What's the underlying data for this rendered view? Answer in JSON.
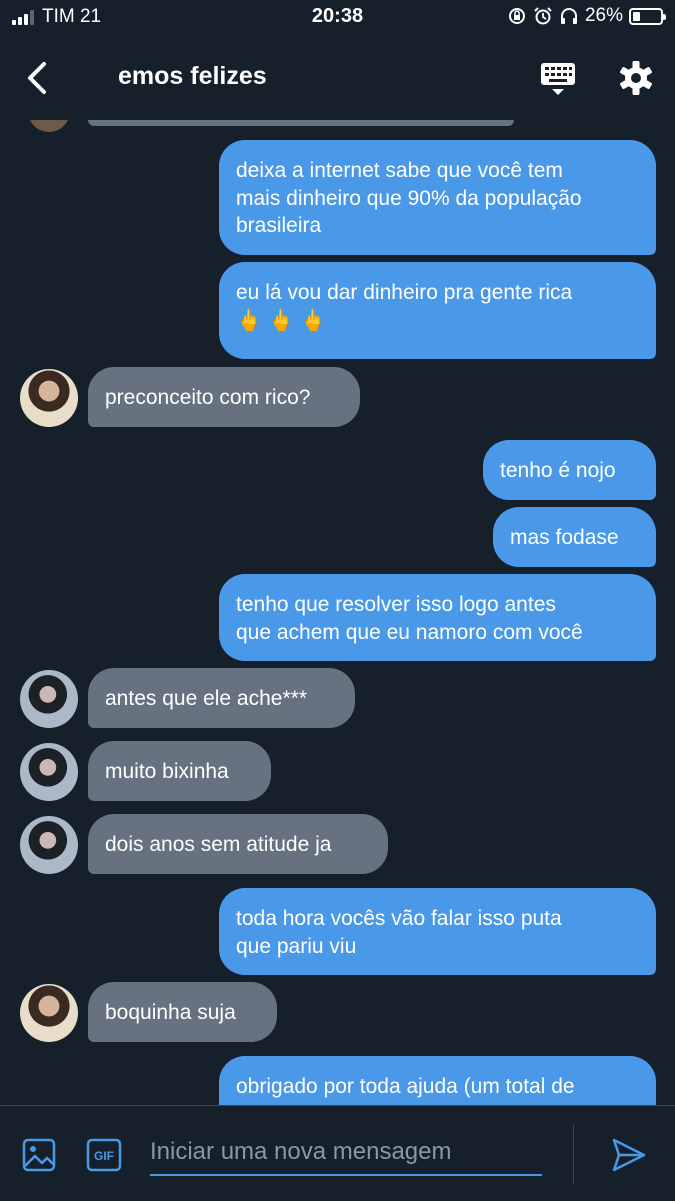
{
  "status_bar": {
    "carrier": "TIM 21",
    "time": "20:38",
    "battery": "26%"
  },
  "header": {
    "title": "emos felizes"
  },
  "messages": [
    {
      "text": "deixa a internet sabe que você tem\nmais dinheiro que 90% da população\nbrasileira"
    },
    {
      "text": "eu lá vou dar dinheiro pra gente rica\n🖕 🖕 🖕"
    },
    {
      "text": "preconceito com rico?"
    },
    {
      "text": "tenho é nojo"
    },
    {
      "text": "mas fodase"
    },
    {
      "text": "tenho que resolver isso logo antes\nque achem que eu namoro com você"
    },
    {
      "text": "antes que ele ache***"
    },
    {
      "text": "muito bixinha"
    },
    {
      "text": "dois anos sem atitude ja"
    },
    {
      "text": "toda hora vocês vão falar isso puta\nque pariu viu"
    },
    {
      "text": "boquinha suja"
    },
    {
      "text": "obrigado por toda ajuda (um total de"
    }
  ],
  "composer": {
    "placeholder": "Iniciar uma nova mensagem",
    "gif_label": "GIF"
  },
  "colors": {
    "background": "#15202b",
    "sent_bubble": "#4a99e9",
    "received_bubble": "#66727f"
  }
}
